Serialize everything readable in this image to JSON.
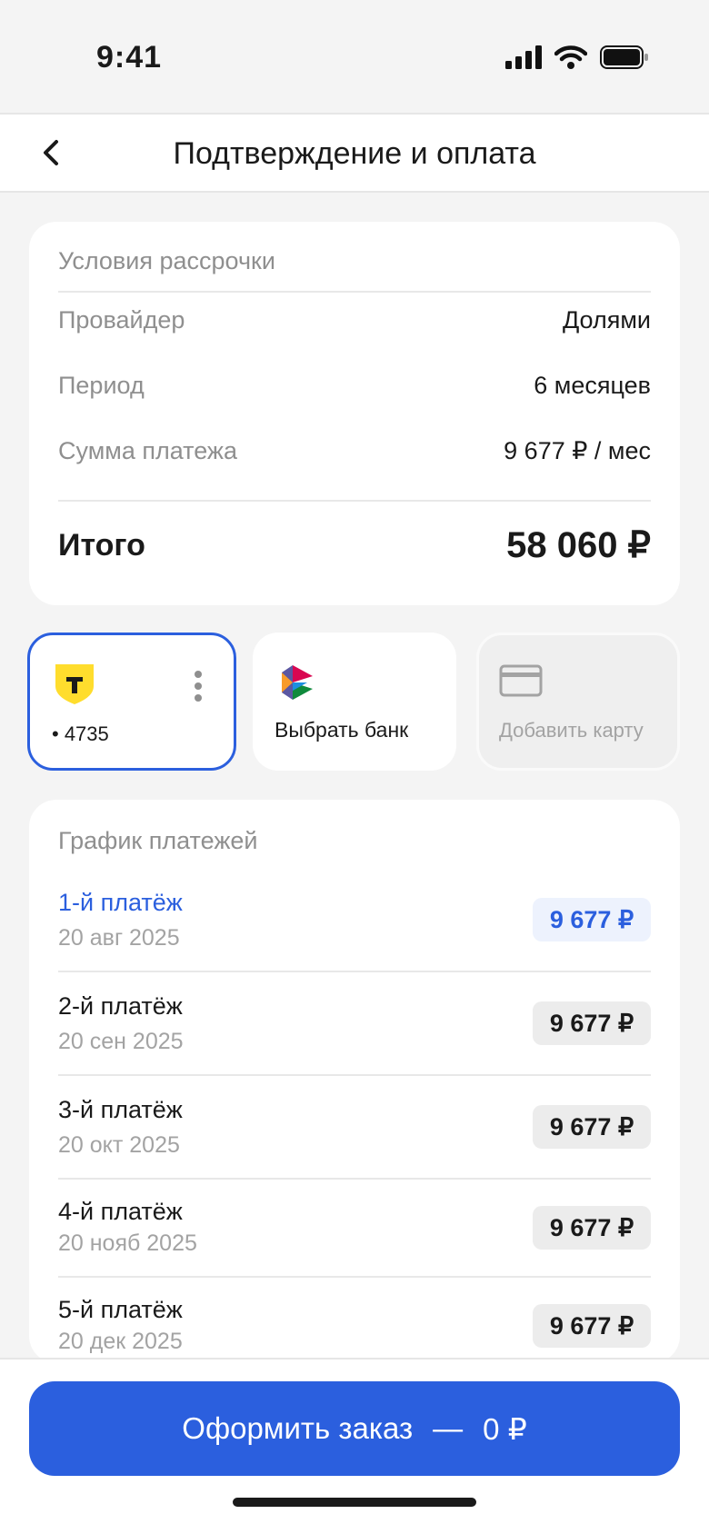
{
  "status": {
    "time": "9:41"
  },
  "header": {
    "title": "Подтверждение и оплата"
  },
  "terms": {
    "title": "Условия рассрочки",
    "rows": [
      {
        "k": "Провайдер",
        "v": "Долями"
      },
      {
        "k": "Период",
        "v": "6 месяцев"
      },
      {
        "k": "Сумма платежа",
        "v": "9 677 ₽ / мес"
      }
    ],
    "total_label": "Итого",
    "total_value": "58 060 ₽"
  },
  "methods": {
    "card_number": "• 4735",
    "bank_label": "Выбрать банк",
    "add_label": "Добавить карту"
  },
  "schedule": {
    "title": "График платежей",
    "items": [
      {
        "n": "1-й платёж",
        "d": "20 авг 2025",
        "a": "9 677 ₽"
      },
      {
        "n": "2-й платёж",
        "d": "20 сен 2025",
        "a": "9 677 ₽"
      },
      {
        "n": "3-й платёж",
        "d": "20 окт 2025",
        "a": "9 677 ₽"
      },
      {
        "n": "4-й платёж",
        "d": "20 нояб 2025",
        "a": "9 677 ₽"
      },
      {
        "n": "5-й платёж",
        "d": "20 дек 2025",
        "a": "9 677 ₽"
      }
    ]
  },
  "cta": {
    "label": "Оформить заказ",
    "sep": "—",
    "amount": "0 ₽"
  },
  "colors": {
    "accent": "#2b5fde",
    "tbank": "#ffdd2d"
  }
}
